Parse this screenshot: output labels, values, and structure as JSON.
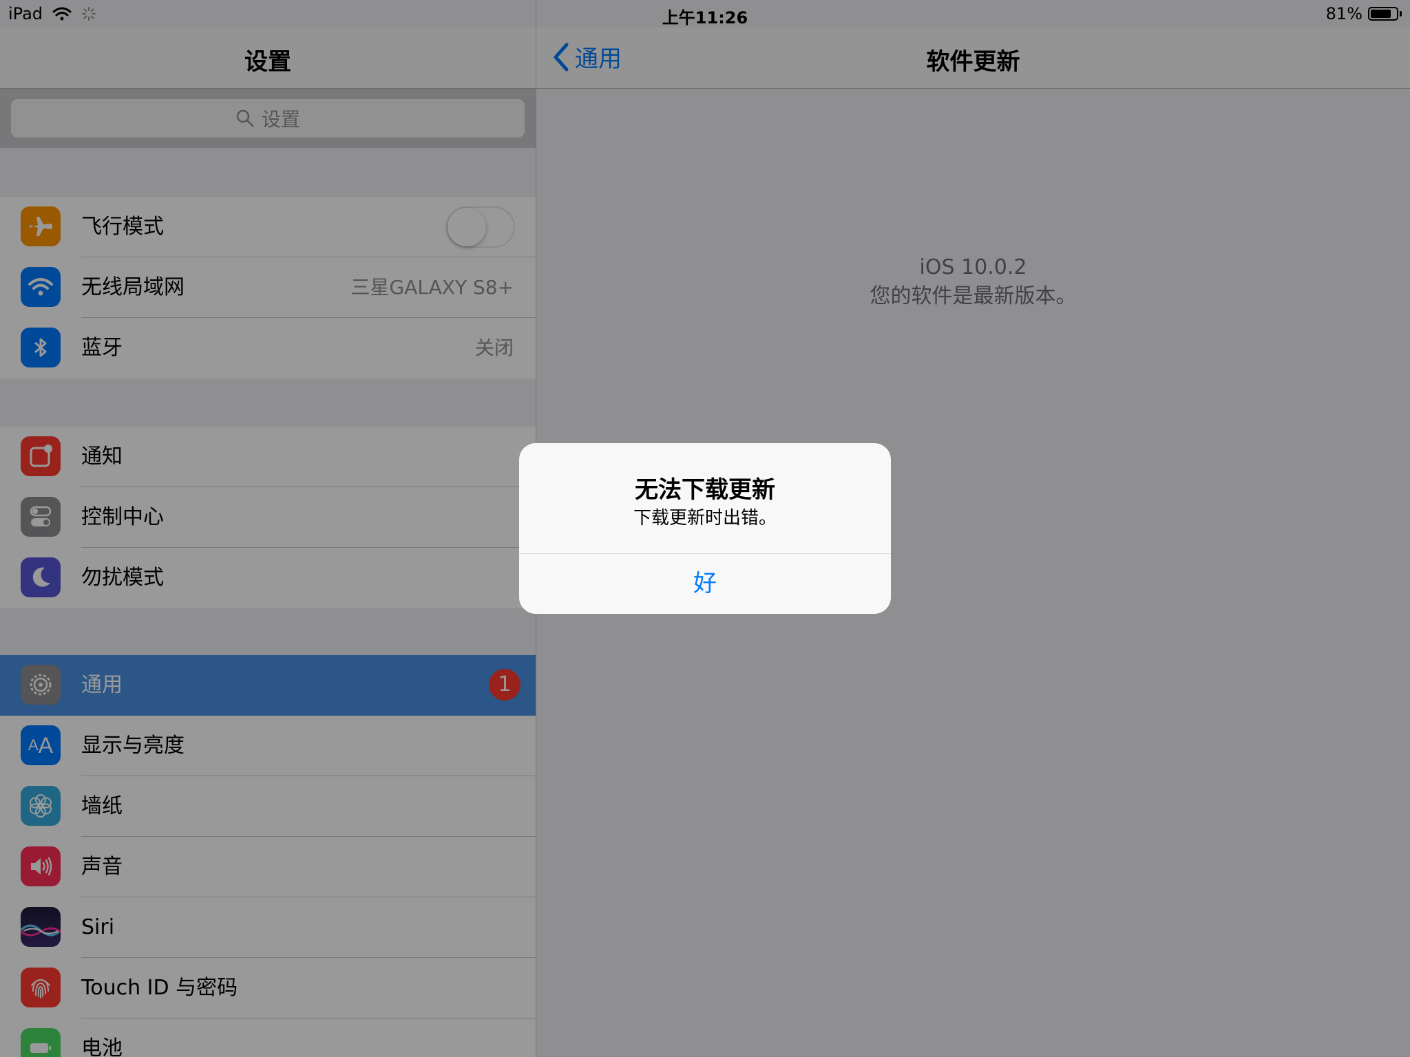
{
  "status_bar": {
    "device": "iPad",
    "time": "上午11:26",
    "battery": "81%",
    "battery_level": 0.81
  },
  "master": {
    "title": "设置",
    "search_placeholder": "设置",
    "groups": [
      [
        {
          "label": "飞行模式",
          "icon": "airplane-icon",
          "color": "#ff9500",
          "toggle": false
        },
        {
          "label": "无线局域网",
          "icon": "wifi-icon",
          "color": "#007aff",
          "detail": "三星GALAXY S8+"
        },
        {
          "label": "蓝牙",
          "icon": "bluetooth-icon",
          "color": "#007aff",
          "detail": "关闭"
        }
      ],
      [
        {
          "label": "通知",
          "icon": "notifications-icon",
          "color": "#ff3b30"
        },
        {
          "label": "控制中心",
          "icon": "control-center-icon",
          "color": "#8e8e93"
        },
        {
          "label": "勿扰模式",
          "icon": "moon-icon",
          "color": "#5856d6"
        }
      ],
      [
        {
          "label": "通用",
          "icon": "gear-icon",
          "color": "#8e8e93",
          "badge": "1",
          "selected": true
        },
        {
          "label": "显示与亮度",
          "icon": "display-icon",
          "color": "#007aff"
        },
        {
          "label": "墙纸",
          "icon": "wallpaper-icon",
          "color": "#34aadc"
        },
        {
          "label": "声音",
          "icon": "sound-icon",
          "color": "#ff2d55"
        },
        {
          "label": "Siri",
          "icon": "siri-icon",
          "color": "#1c1c3a"
        },
        {
          "label": "Touch ID 与密码",
          "icon": "fingerprint-icon",
          "color": "#ff3b30"
        },
        {
          "label": "电池",
          "icon": "battery-icon",
          "color": "#4cd964"
        }
      ]
    ]
  },
  "detail": {
    "back_label": "通用",
    "title": "软件更新",
    "version": "iOS 10.0.2",
    "status": "您的软件是最新版本。"
  },
  "alert": {
    "title": "无法下载更新",
    "message": "下载更新时出错。",
    "button": "好"
  },
  "colors": {
    "accent": "#007aff",
    "selected_row": "#4a90e2",
    "badge": "#ff3b30"
  }
}
